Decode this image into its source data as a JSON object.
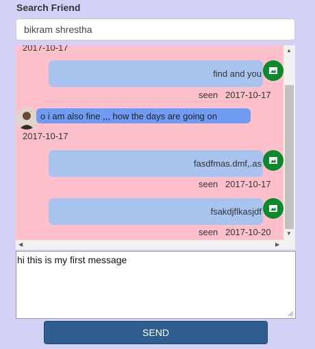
{
  "search": {
    "label": "Search Friend",
    "value": "bikram shrestha"
  },
  "chat": {
    "top_date": "2017-10-17",
    "messages": [
      {
        "direction": "sent",
        "text": "find and you",
        "status": "seen",
        "date": "2017-10-17",
        "avatar_icon": "green-user-icon"
      },
      {
        "direction": "received",
        "text": "o i am also fine ,,, how the days are going on",
        "date": "2017-10-17",
        "avatar_icon": "friend-photo"
      },
      {
        "direction": "sent",
        "text": "fasdfmas.dmf,.as",
        "status": "seen",
        "date": "2017-10-17",
        "avatar_icon": "green-user-icon"
      },
      {
        "direction": "sent",
        "text": "fsakdjflkasjdf",
        "status": "seen",
        "date": "2017-10-20",
        "avatar_icon": "green-user-icon"
      }
    ],
    "colors": {
      "panel_bg": "#fec0cb",
      "sent_bubble": "#aac4f0",
      "received_bubble": "#6f9cf2",
      "avatar_green": "#0a8a2c"
    }
  },
  "composer": {
    "value": "hi this is my first message"
  },
  "send_button": {
    "label": "SEND",
    "color": "#2e5e8e"
  },
  "icons": [
    "scroll-up-arrow-icon",
    "scroll-down-arrow-icon",
    "scroll-left-arrow-icon",
    "scroll-right-arrow-icon",
    "resize-grip-icon"
  ]
}
